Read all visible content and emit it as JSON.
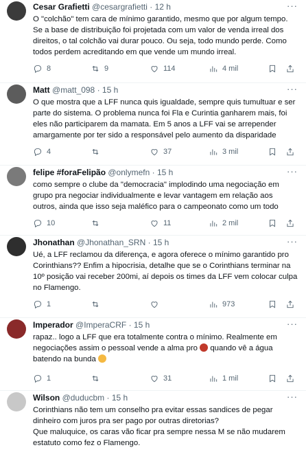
{
  "icons": {
    "reply": "reply-icon",
    "retweet": "retweet-icon",
    "like": "like-icon",
    "views": "views-icon",
    "bookmark": "bookmark-icon",
    "share": "share-icon",
    "more": "more-icon"
  },
  "tweets": [
    {
      "name": "Cesar Grafietti",
      "handle": "@cesargrafietti",
      "dot": "·",
      "time": "12 h",
      "text": "O \"colchão\" tem cara de mínimo garantido, mesmo que por algum tempo.\nSe a base de distribuição foi projetada com um valor de venda irreal dos direitos, o tal colchão vai durar pouco. Ou seja, todo mundo perde. Como todos perdem acreditando em que vende um mundo irreal.",
      "replies": "8",
      "retweets": "9",
      "likes": "114",
      "views": "4 mil",
      "avatar_color": "#3b3b3b"
    },
    {
      "name": "Matt",
      "handle": "@matt_098",
      "dot": "·",
      "time": "15 h",
      "text": "O que mostra que a LFF nunca quis igualdade, sempre quis tumultuar e ser parte do sistema. O problema nunca foi Fla e Curintia ganharem mais, foi eles não participarem da mamata. Em 5 anos a LFF vai se arrepender amargamente por ter sido a responsável pelo aumento da disparidade",
      "replies": "4",
      "retweets": "",
      "likes": "37",
      "views": "3 mil",
      "avatar_color": "#5c5c5c"
    },
    {
      "name": "felipe #foraFelipão",
      "handle": "@onlymefn",
      "dot": "·",
      "time": "15 h",
      "text": "como sempre o clube da \"democracia\" implodindo uma negociação em grupo pra negociar individualmente e levar vantagem em relação aos outros, ainda que isso seja maléfico para o campeonato como um todo",
      "replies": "10",
      "retweets": "",
      "likes": "11",
      "views": "2 mil",
      "avatar_color": "#7a7a7a"
    },
    {
      "name": "Jhonathan",
      "handle": "@Jhonathan_SRN",
      "dot": "·",
      "time": "15 h",
      "text": "Ué, a LFF reclamou da diferença, e agora oferece o mínimo garantido pro Corinthians?? Enfim a hipocrisia, detalhe que se o Corinthians terminar na 10º posição vai receber 200mi, aí depois os times da LFF vem colocar culpa no Flamengo.",
      "replies": "1",
      "retweets": "",
      "likes": "",
      "views": "973",
      "avatar_color": "#2e2e2e"
    },
    {
      "name": "Imperador",
      "handle": "@ImperaCRF",
      "dot": "·",
      "time": "15 h",
      "text_parts": [
        "rapaz.. logo a LFF que era totalmente contra o mínimo. Realmente em negociações assim o pessoal vende a alma pro ",
        " quando vê a água batendo na bunda "
      ],
      "replies": "1",
      "retweets": "",
      "likes": "31",
      "views": "1 mil",
      "avatar_color": "#8a2a2a",
      "emoji_colors": [
        "#c0392b",
        "#f5b942"
      ]
    },
    {
      "name": "Wilson",
      "handle": "@duducbm",
      "dot": "·",
      "time": "15 h",
      "text": "Corinthians não tem um conselho pra evitar essas sandices de pegar dinheiro com juros pra ser pago por outras diretorias?\nQue maluquice, os caras vão ficar pra sempre nessa M se não mudarem estatuto como fez o Flamengo.",
      "avatar_color": "#c8c8c8"
    }
  ]
}
